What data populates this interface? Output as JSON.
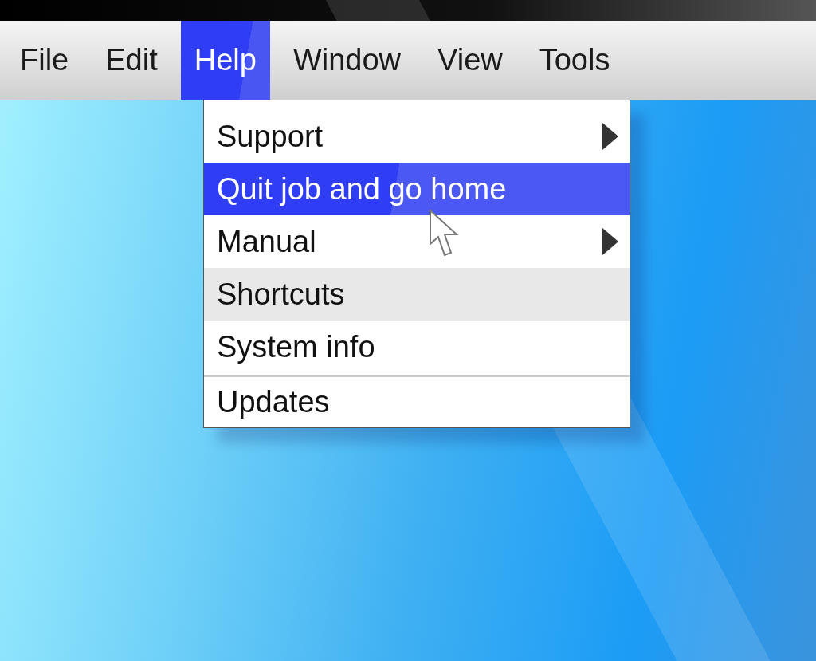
{
  "menubar": [
    {
      "label": "File",
      "selected": false
    },
    {
      "label": "Edit",
      "selected": false
    },
    {
      "label": "Help",
      "selected": true
    },
    {
      "label": "Window",
      "selected": false
    },
    {
      "label": "View",
      "selected": false
    },
    {
      "label": "Tools",
      "selected": false
    }
  ],
  "menu": {
    "items": [
      {
        "label": "Support",
        "submenu": true,
        "selected": false,
        "shaded": false,
        "separator_before": false
      },
      {
        "label": "Quit job and go home",
        "submenu": false,
        "selected": true,
        "shaded": false,
        "separator_before": false
      },
      {
        "label": "Manual",
        "submenu": true,
        "selected": false,
        "shaded": false,
        "separator_before": false
      },
      {
        "label": "Shortcuts",
        "submenu": false,
        "selected": false,
        "shaded": true,
        "separator_before": false
      },
      {
        "label": "System info",
        "submenu": false,
        "selected": false,
        "shaded": false,
        "separator_before": false
      },
      {
        "label": "Updates",
        "submenu": false,
        "selected": false,
        "shaded": false,
        "separator_before": true
      }
    ]
  }
}
